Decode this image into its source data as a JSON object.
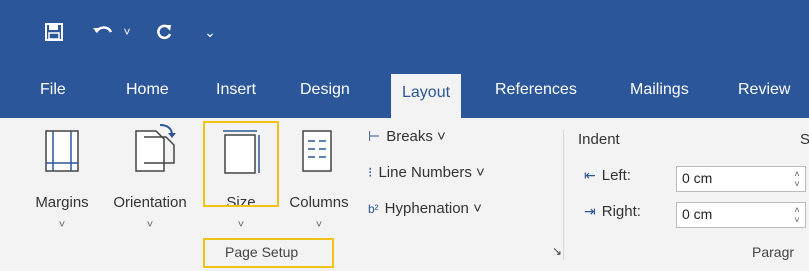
{
  "quick_access": {
    "save_icon": "save-icon",
    "undo_icon": "undo-icon",
    "undo_dropdown": "˅",
    "redo_icon": "redo-icon",
    "customize": "⌄"
  },
  "tabs": [
    {
      "label": "File"
    },
    {
      "label": "Home"
    },
    {
      "label": "Insert"
    },
    {
      "label": "Design"
    },
    {
      "label": "Layout"
    },
    {
      "label": "References"
    },
    {
      "label": "Mailings"
    },
    {
      "label": "Review"
    }
  ],
  "page_setup": {
    "margins_label": "Margins",
    "orientation_label": "Orientation",
    "size_label": "Size",
    "columns_label": "Columns",
    "breaks_label": "Breaks ˅",
    "line_numbers_label": "Line Numbers ˅",
    "hyphenation_label": "Hyphenation ˅",
    "group_label": "Page Setup",
    "launcher": "↘"
  },
  "indent": {
    "title": "Indent",
    "left_label": "Left:",
    "left_value": "0 cm",
    "right_label": "Right:",
    "right_value": "0 cm"
  },
  "paragraph": {
    "group_label": "Paragr",
    "spacing_partial": "S"
  },
  "highlight_color": "#f2c216",
  "accent": "#2b579a"
}
